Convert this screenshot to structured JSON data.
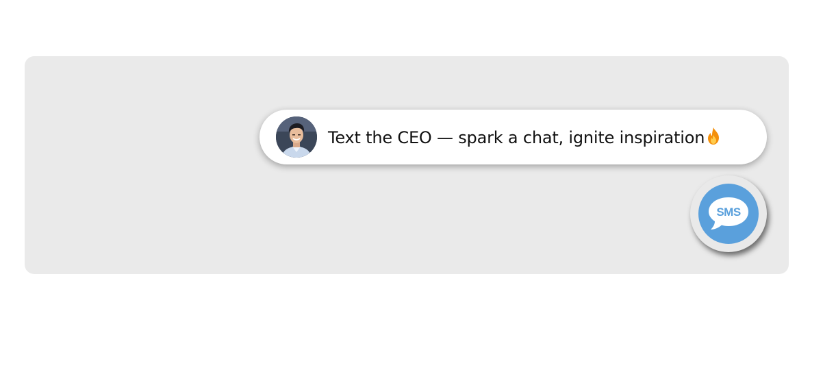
{
  "widget": {
    "prompt_text": "Text the CEO — spark a chat, ignite inspiration",
    "prompt_icon": "fire-icon",
    "avatar_icon": "ceo-portrait",
    "sms_button_label": "SMS",
    "sms_icon": "speech-bubble-icon"
  },
  "colors": {
    "panel_background": "#eaeaea",
    "pill_background": "#ffffff",
    "sms_accent": "#5aa0dc",
    "sms_ring": "#e9e9e9"
  }
}
